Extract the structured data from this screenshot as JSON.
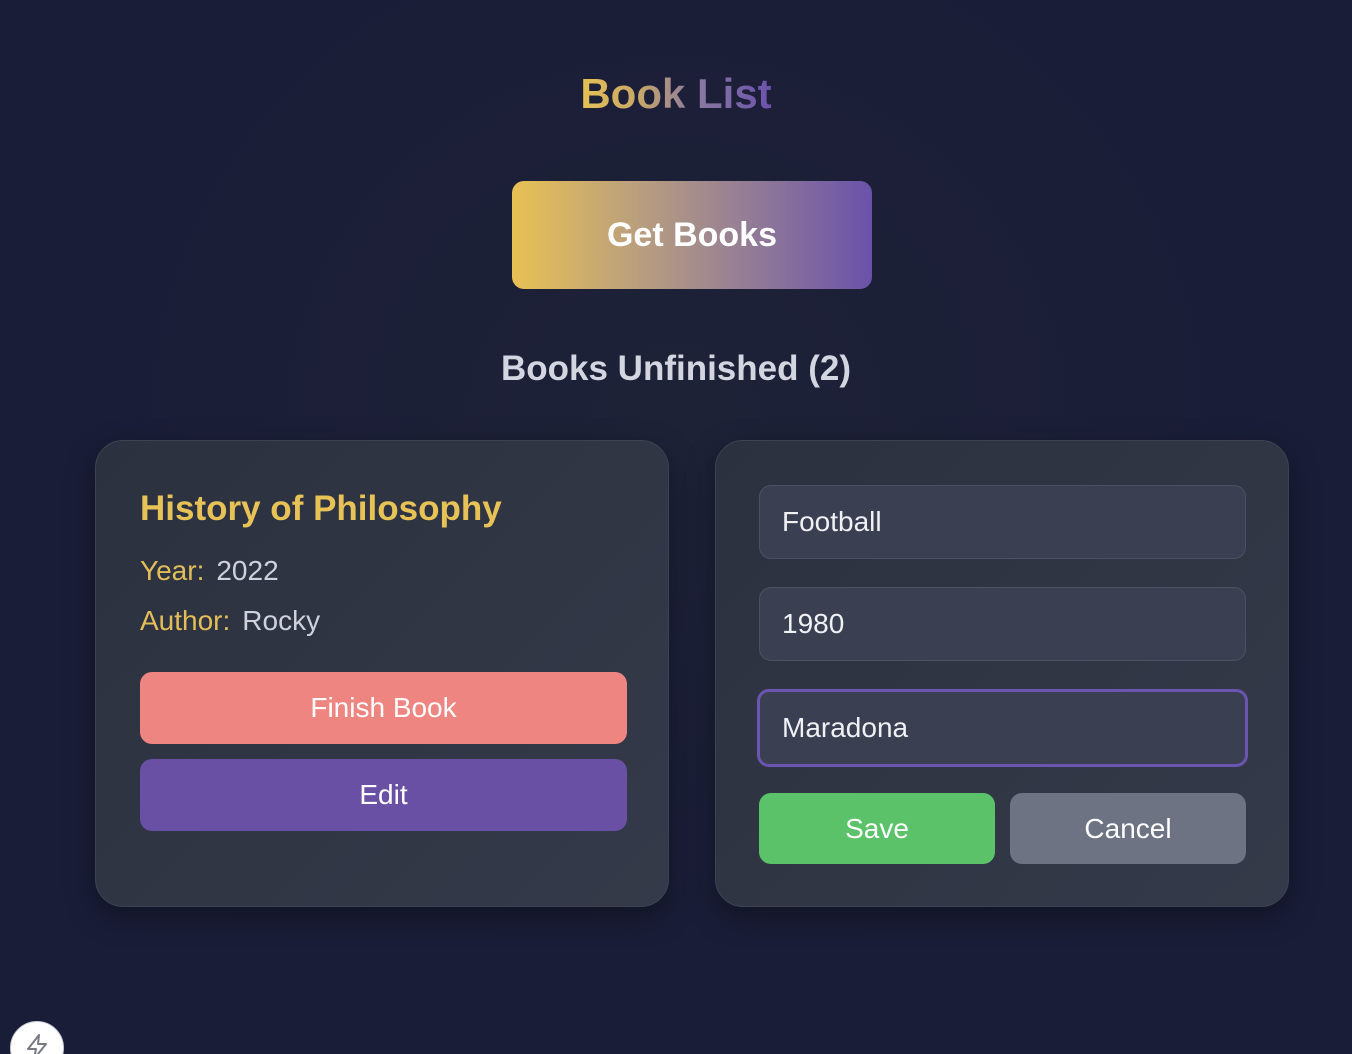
{
  "header": {
    "title": "Book List"
  },
  "actions": {
    "get_books_label": "Get Books"
  },
  "section": {
    "heading": "Books Unfinished (2)"
  },
  "book_card": {
    "title": "History of Philosophy",
    "year_label": "Year:",
    "year_value": "2022",
    "author_label": "Author:",
    "author_value": "Rocky",
    "finish_label": "Finish Book",
    "edit_label": "Edit"
  },
  "edit_form": {
    "title_value": "Football",
    "year_value": "1980",
    "author_value": "Maradona",
    "save_label": "Save",
    "cancel_label": "Cancel"
  },
  "floating_button": {
    "icon": "lightning-icon"
  },
  "colors": {
    "background": "#1a1d37",
    "accent_gold": "#e7c256",
    "accent_purple": "#6950a4",
    "finish_button": "#ef8580",
    "save_button": "#5cc26a",
    "cancel_button": "#6d7383"
  }
}
